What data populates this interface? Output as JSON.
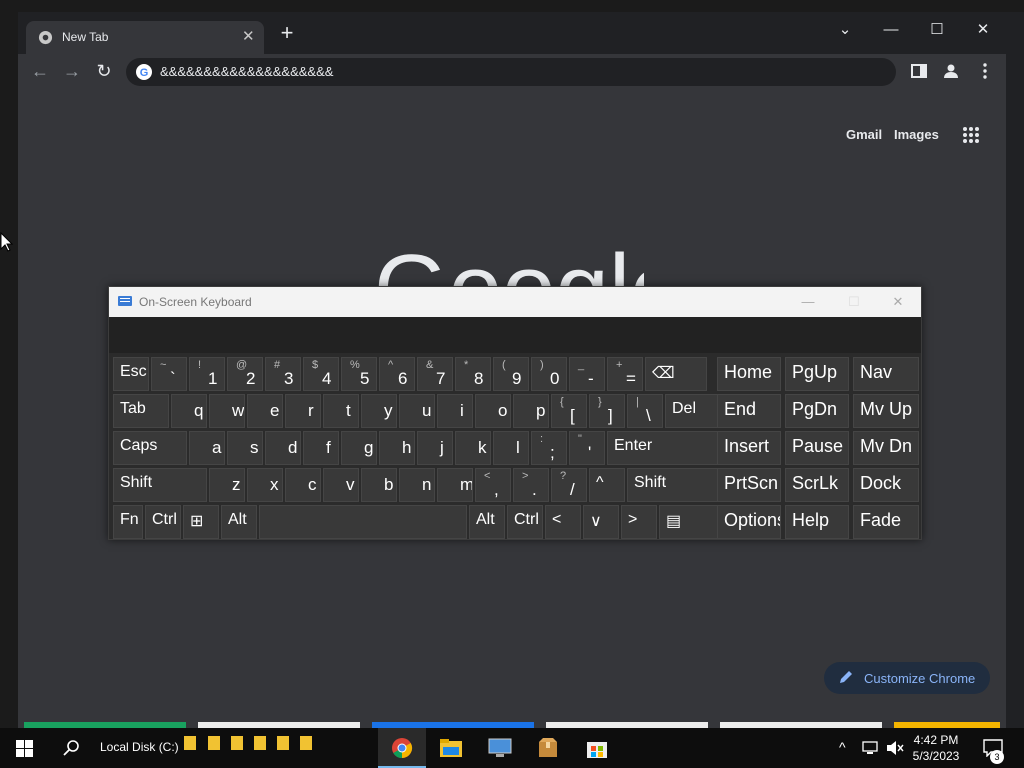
{
  "browser": {
    "tab_title": "New Tab",
    "tab_close": "✕",
    "new_tab": "+",
    "window_controls": [
      "⌄",
      "—",
      "☐",
      "✕"
    ],
    "address": "&&&&&&&&&&&&&&&&&&&&",
    "ntp": {
      "gmail": "Gmail",
      "images": "Images",
      "logo_text": "Google",
      "customize": "Customize Chrome"
    },
    "colors": {
      "tab_bg": "#35363a",
      "frame": "#202124",
      "link_blue": "#8ab4f8"
    }
  },
  "osk": {
    "title": "On-Screen Keyboard",
    "controls": [
      "—",
      "☐",
      "✕"
    ],
    "row1": [
      {
        "label": "Esc"
      },
      {
        "sec": "~",
        "prim": "`"
      },
      {
        "sec": "!",
        "prim": "1"
      },
      {
        "sec": "@",
        "prim": "2"
      },
      {
        "sec": "#",
        "prim": "3"
      },
      {
        "sec": "$",
        "prim": "4"
      },
      {
        "sec": "%",
        "prim": "5"
      },
      {
        "sec": "^",
        "prim": "6"
      },
      {
        "sec": "&",
        "prim": "7"
      },
      {
        "sec": "*",
        "prim": "8"
      },
      {
        "sec": "(",
        "prim": "9"
      },
      {
        "sec": ")",
        "prim": "0"
      },
      {
        "sec": "_",
        "prim": "-"
      },
      {
        "sec": "+",
        "prim": "="
      },
      {
        "label": "⌫"
      }
    ],
    "row2": [
      {
        "label": "Tab"
      },
      {
        "label": "q"
      },
      {
        "label": "w"
      },
      {
        "label": "e"
      },
      {
        "label": "r"
      },
      {
        "label": "t"
      },
      {
        "label": "y"
      },
      {
        "label": "u"
      },
      {
        "label": "i"
      },
      {
        "label": "o"
      },
      {
        "label": "p"
      },
      {
        "sec": "{",
        "prim": "["
      },
      {
        "sec": "}",
        "prim": "]"
      },
      {
        "sec": "|",
        "prim": "\\"
      },
      {
        "label": "Del"
      }
    ],
    "row3": [
      {
        "label": "Caps"
      },
      {
        "label": "a"
      },
      {
        "label": "s"
      },
      {
        "label": "d"
      },
      {
        "label": "f"
      },
      {
        "label": "g"
      },
      {
        "label": "h"
      },
      {
        "label": "j"
      },
      {
        "label": "k"
      },
      {
        "label": "l"
      },
      {
        "sec": ":",
        "prim": ";"
      },
      {
        "sec": "\"",
        "prim": "'"
      },
      {
        "label": "Enter"
      }
    ],
    "row4": [
      {
        "label": "Shift"
      },
      {
        "label": "z"
      },
      {
        "label": "x"
      },
      {
        "label": "c"
      },
      {
        "label": "v"
      },
      {
        "label": "b"
      },
      {
        "label": "n"
      },
      {
        "label": "m"
      },
      {
        "sec": "<",
        "prim": ","
      },
      {
        "sec": ">",
        "prim": "."
      },
      {
        "sec": "?",
        "prim": "/"
      },
      {
        "label": "^"
      },
      {
        "label": "Shift"
      }
    ],
    "row5": [
      {
        "label": "Fn"
      },
      {
        "label": "Ctrl"
      },
      {
        "label": "⊞"
      },
      {
        "label": "Alt"
      },
      {
        "label": ""
      },
      {
        "label": "Alt"
      },
      {
        "label": "Ctrl"
      },
      {
        "label": "<"
      },
      {
        "label": "∨"
      },
      {
        "label": ">"
      },
      {
        "label": "▤"
      }
    ],
    "nav_rows": [
      [
        "Home",
        "PgUp",
        "Nav"
      ],
      [
        "End",
        "PgDn",
        "Mv Up"
      ],
      [
        "Insert",
        "Pause",
        "Mv Dn"
      ],
      [
        "PrtScn",
        "ScrLk",
        "Dock"
      ],
      [
        "Options",
        "Help",
        "Fade"
      ]
    ]
  },
  "taskbar": {
    "search_label": "Local Disk (C:)",
    "time": "4:42 PM",
    "date": "5/3/2023",
    "notification_count": "3"
  }
}
